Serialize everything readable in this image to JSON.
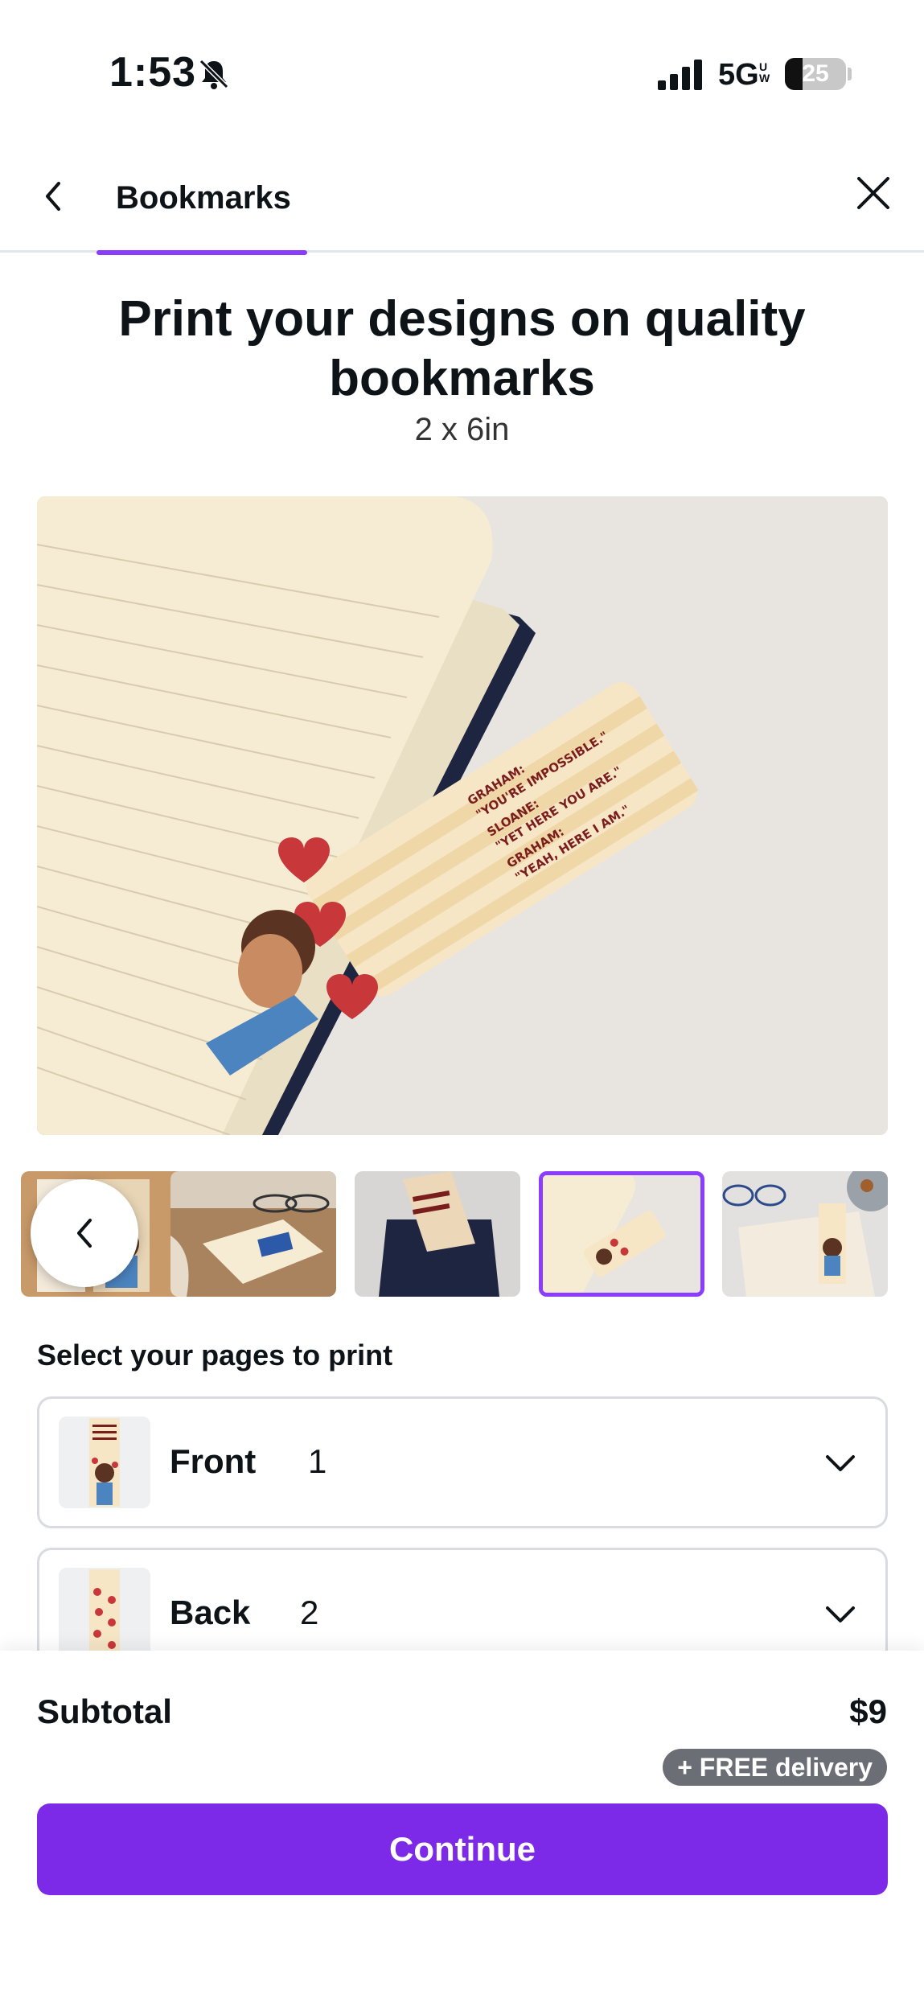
{
  "status_bar": {
    "time": "1:53",
    "network": "5G",
    "network_sup": "UW",
    "battery": "25"
  },
  "header": {
    "tab_label": "Bookmarks"
  },
  "product": {
    "title": "Print your designs on quality bookmarks",
    "size": "2 x 6in"
  },
  "hero_bookmark_text": {
    "lines": [
      "GRAHAM:",
      "\"YOU'RE IMPOSSIBLE.\"",
      "SLOANE:",
      "\"YET HERE YOU ARE.\"",
      "GRAHAM:",
      "\"YEAH, HERE I AM.\""
    ]
  },
  "thumbnails": {
    "count": 5,
    "selected_index": 3
  },
  "pages_section": {
    "label": "Select your pages to print",
    "rows": [
      {
        "name": "Front",
        "number": "1"
      },
      {
        "name": "Back",
        "number": "2"
      }
    ]
  },
  "checkout": {
    "subtotal_label": "Subtotal",
    "subtotal_value": "$9",
    "delivery_badge": "+ FREE delivery",
    "continue_label": "Continue"
  },
  "colors": {
    "accent": "#8b3dff",
    "button": "#7d2ae8",
    "badge": "#6b6f75"
  }
}
